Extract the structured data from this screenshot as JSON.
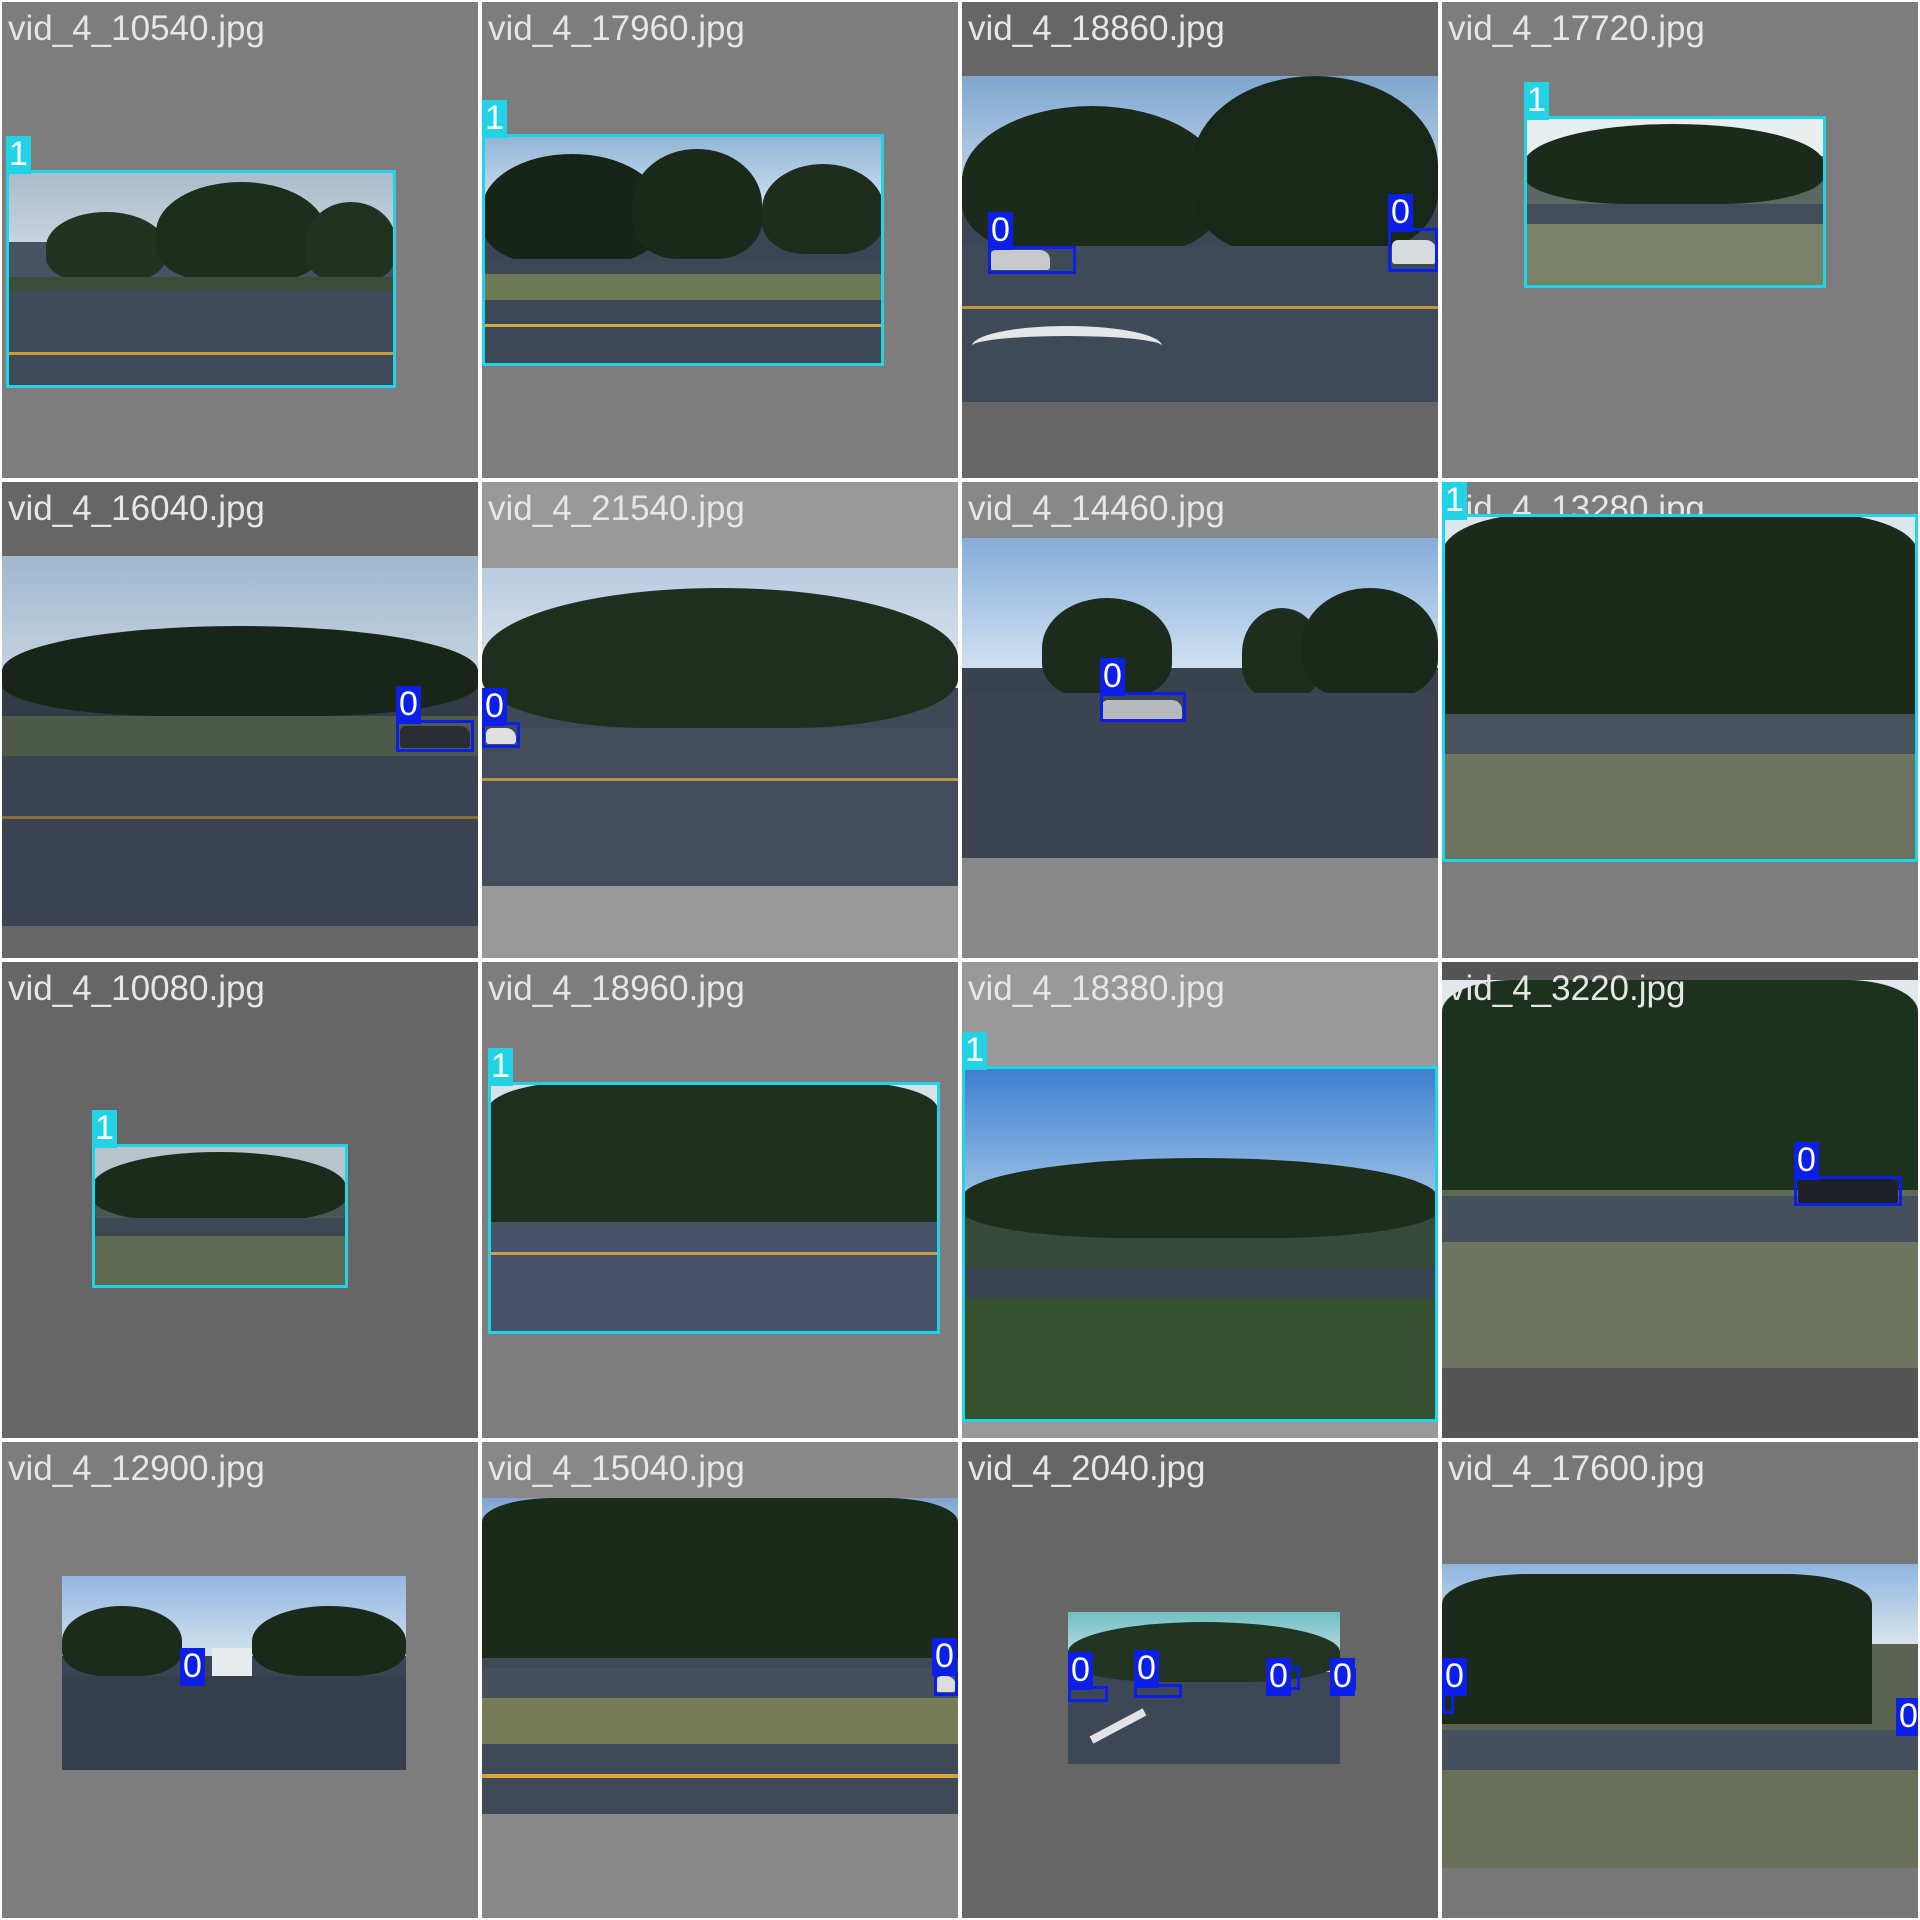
{
  "colors": {
    "class_0_box": "#0b1fe8",
    "class_1_box": "#22d3e6",
    "title_text": "#e6e6e6"
  },
  "tiles": [
    {
      "title": "vid_4_10540.jpg",
      "boxes": [
        {
          "label": "1"
        }
      ]
    },
    {
      "title": "vid_4_17960.jpg",
      "boxes": [
        {
          "label": "1"
        }
      ]
    },
    {
      "title": "vid_4_18860.jpg",
      "boxes": [
        {
          "label": "0"
        },
        {
          "label": "0"
        }
      ]
    },
    {
      "title": "vid_4_17720.jpg",
      "boxes": [
        {
          "label": "1"
        }
      ]
    },
    {
      "title": "vid_4_16040.jpg",
      "boxes": [
        {
          "label": "0"
        }
      ]
    },
    {
      "title": "vid_4_21540.jpg",
      "boxes": [
        {
          "label": "0"
        }
      ]
    },
    {
      "title": "vid_4_14460.jpg",
      "boxes": [
        {
          "label": "0"
        }
      ]
    },
    {
      "title": "vid_4_13280.jpg",
      "boxes": [
        {
          "label": "1"
        }
      ]
    },
    {
      "title": "vid_4_10080.jpg",
      "boxes": [
        {
          "label": "1"
        }
      ]
    },
    {
      "title": "vid_4_18960.jpg",
      "boxes": [
        {
          "label": "1"
        }
      ]
    },
    {
      "title": "vid_4_18380.jpg",
      "boxes": [
        {
          "label": "1"
        }
      ]
    },
    {
      "title": "vid_4_3220.jpg",
      "boxes": [
        {
          "label": "0"
        }
      ]
    },
    {
      "title": "vid_4_12900.jpg",
      "boxes": [
        {
          "label": "0"
        }
      ]
    },
    {
      "title": "vid_4_15040.jpg",
      "boxes": [
        {
          "label": "0"
        }
      ]
    },
    {
      "title": "vid_4_2040.jpg",
      "boxes": [
        {
          "label": "0"
        },
        {
          "label": "0"
        },
        {
          "label": "0"
        },
        {
          "label": "0"
        }
      ]
    },
    {
      "title": "vid_4_17600.jpg",
      "boxes": [
        {
          "label": "0"
        },
        {
          "label": "0"
        }
      ]
    }
  ]
}
